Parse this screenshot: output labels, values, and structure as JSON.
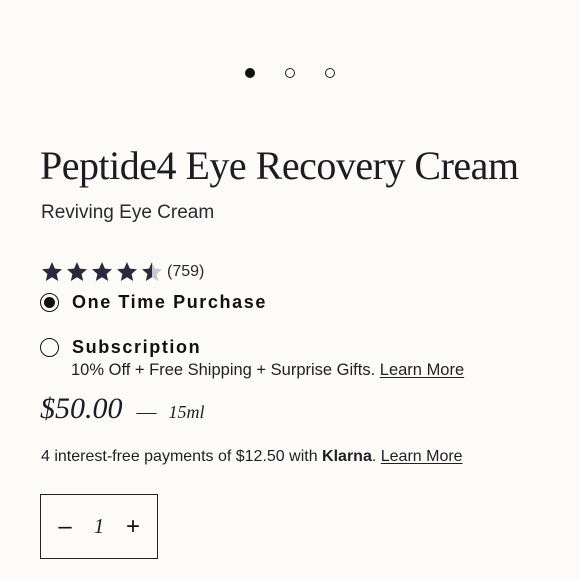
{
  "carousel": {
    "count": 3,
    "active_index": 0
  },
  "product": {
    "title": "Peptide4 Eye Recovery Cream",
    "subtitle": "Reviving Eye Cream",
    "rating": {
      "stars": 4.5,
      "count_text": "(759)"
    },
    "star_color": "#2a2a3d",
    "star_empty_color": "#c7c7cf"
  },
  "purchase_options": {
    "one_time": {
      "label": "One Time Purchase",
      "selected": true
    },
    "subscription": {
      "label": "Subscription",
      "selected": false,
      "description": "10% Off + Free Shipping + Surprise Gifts.",
      "link_text": "Learn More"
    }
  },
  "price": {
    "amount": "$50.00",
    "separator": "—",
    "size": "15ml"
  },
  "klarna": {
    "text": "4 interest-free payments of $12.50 with ",
    "brand": "Klarna",
    "brand_suffix": ".",
    "link_text": "Learn More"
  },
  "quantity": {
    "minus": "–",
    "value": "1",
    "plus": "+"
  }
}
